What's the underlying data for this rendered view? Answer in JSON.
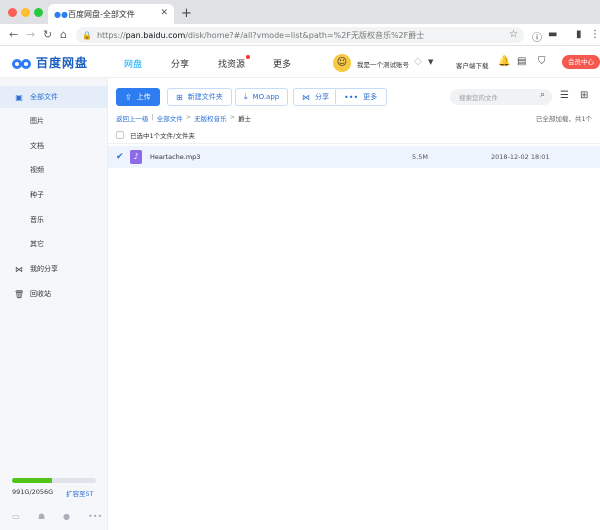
{
  "browser": {
    "tab_title": "百度网盘-全部文件",
    "url_prefix": "https://",
    "url_host": "pan.baidu.com",
    "url_path": "/disk/home?#/all?vmode=list&path=%2F无版权音乐%2F爵士",
    "colors": {
      "close": "#fd5f57",
      "minimize": "#febc2e",
      "maximize": "#28c840"
    }
  },
  "header": {
    "logo_text": "百度网盘",
    "nav": [
      "网盘",
      "分享",
      "找资源",
      "更多"
    ],
    "user_name": "我是一个测试账号",
    "client_download": "客户端下载",
    "vip_label": "会员中心",
    "accent": "#06a7ff"
  },
  "sidebar": {
    "items": [
      {
        "label": "全部文件",
        "icon": "files-icon"
      },
      {
        "label": "图片"
      },
      {
        "label": "文档"
      },
      {
        "label": "视频"
      },
      {
        "label": "种子"
      },
      {
        "label": "音乐"
      },
      {
        "label": "其它"
      },
      {
        "label": "我的分享",
        "icon": "share-icon"
      },
      {
        "label": "回收站",
        "icon": "trash-icon"
      }
    ],
    "quota_text": "991G/2056G",
    "quota_fraction": 0.48,
    "expand_label": "扩容至5T"
  },
  "toolbar": {
    "upload": "上传",
    "new_folder": "新建文件夹",
    "mo_app": "MO.app",
    "share": "分享",
    "more": "更多",
    "search_placeholder": "搜索您的文件"
  },
  "breadcrumb": {
    "back": "返回上一级",
    "all": "全部文件",
    "folder": "无版权音乐",
    "current": "爵士",
    "loaded": "已全部加载，共1个"
  },
  "list": {
    "selected_text": "已选中1个文件/文件夹",
    "files": [
      {
        "name": "Heartache.mp3",
        "size": "5.5M",
        "date": "2018-12-02 18:01"
      }
    ]
  }
}
